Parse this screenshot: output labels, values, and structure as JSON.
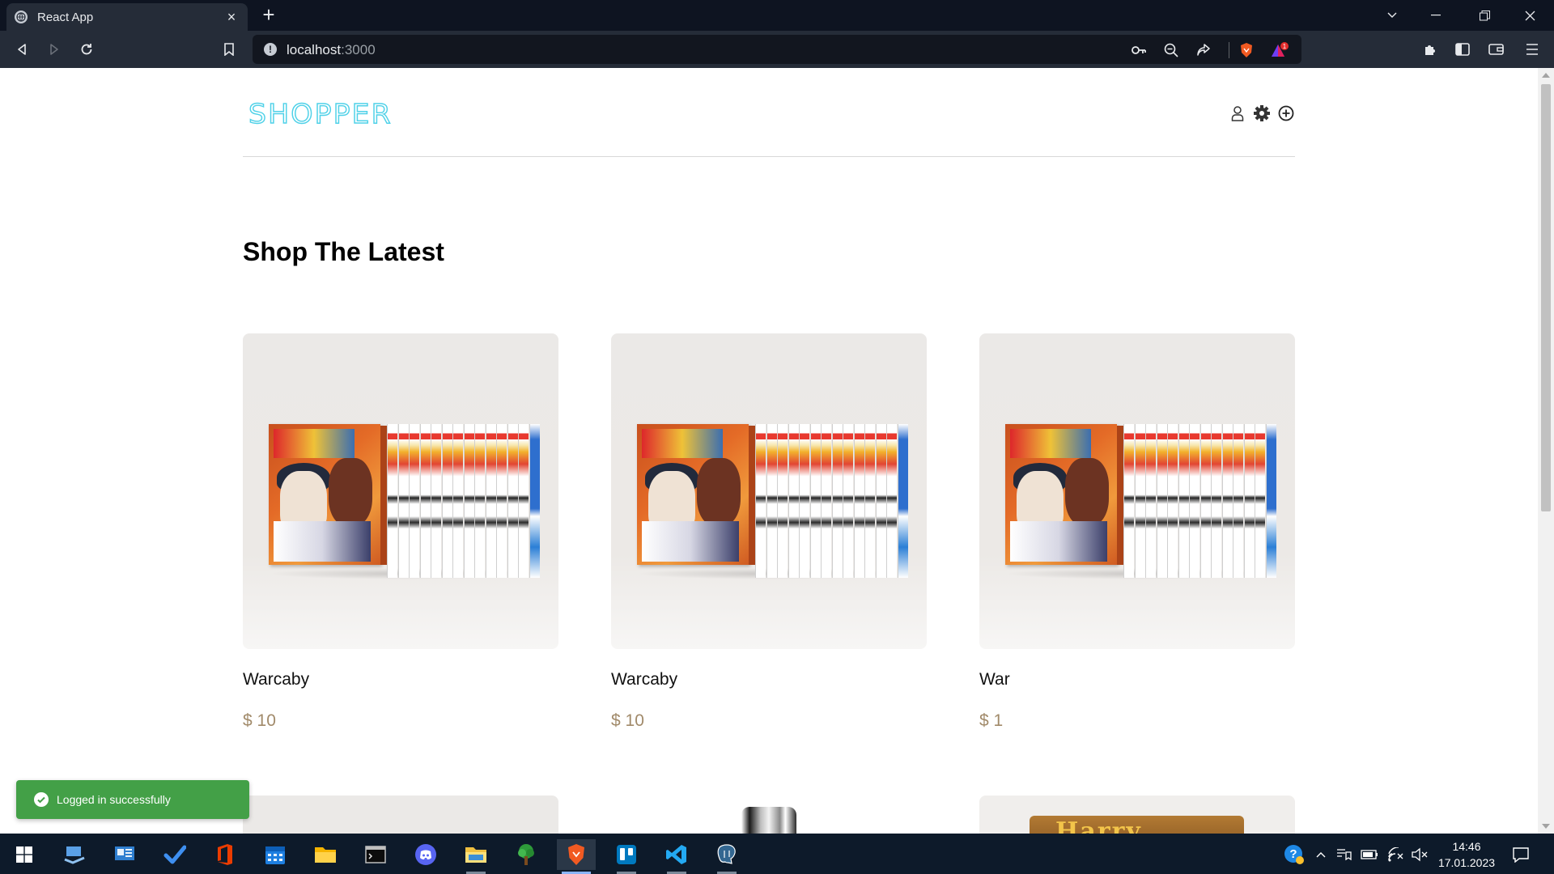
{
  "browser": {
    "tab_title": "React App",
    "tab_close": "×",
    "new_tab": "+",
    "url_host": "localhost",
    "url_port": ":3000",
    "extension_badge": "1"
  },
  "page": {
    "logo": "SHOPPER",
    "section_title": "Shop The Latest",
    "products": [
      {
        "name": "Warcaby",
        "price": "$ 10"
      },
      {
        "name": "Warcaby",
        "price": "$ 10"
      },
      {
        "name": "War",
        "price": "$ 1"
      }
    ],
    "partial_row_text": "Harry Potter"
  },
  "toast": {
    "message": "Logged in successfully"
  },
  "taskbar": {
    "time": "14:46",
    "date": "17.01.2023"
  },
  "colors": {
    "logo_stroke": "#4fd1e8",
    "price": "#a18a6a",
    "toast_bg": "#43a047",
    "chrome_bg": "#252c38",
    "tab_strip_bg": "#0e1421",
    "taskbar_bg": "#0d1a2a"
  }
}
